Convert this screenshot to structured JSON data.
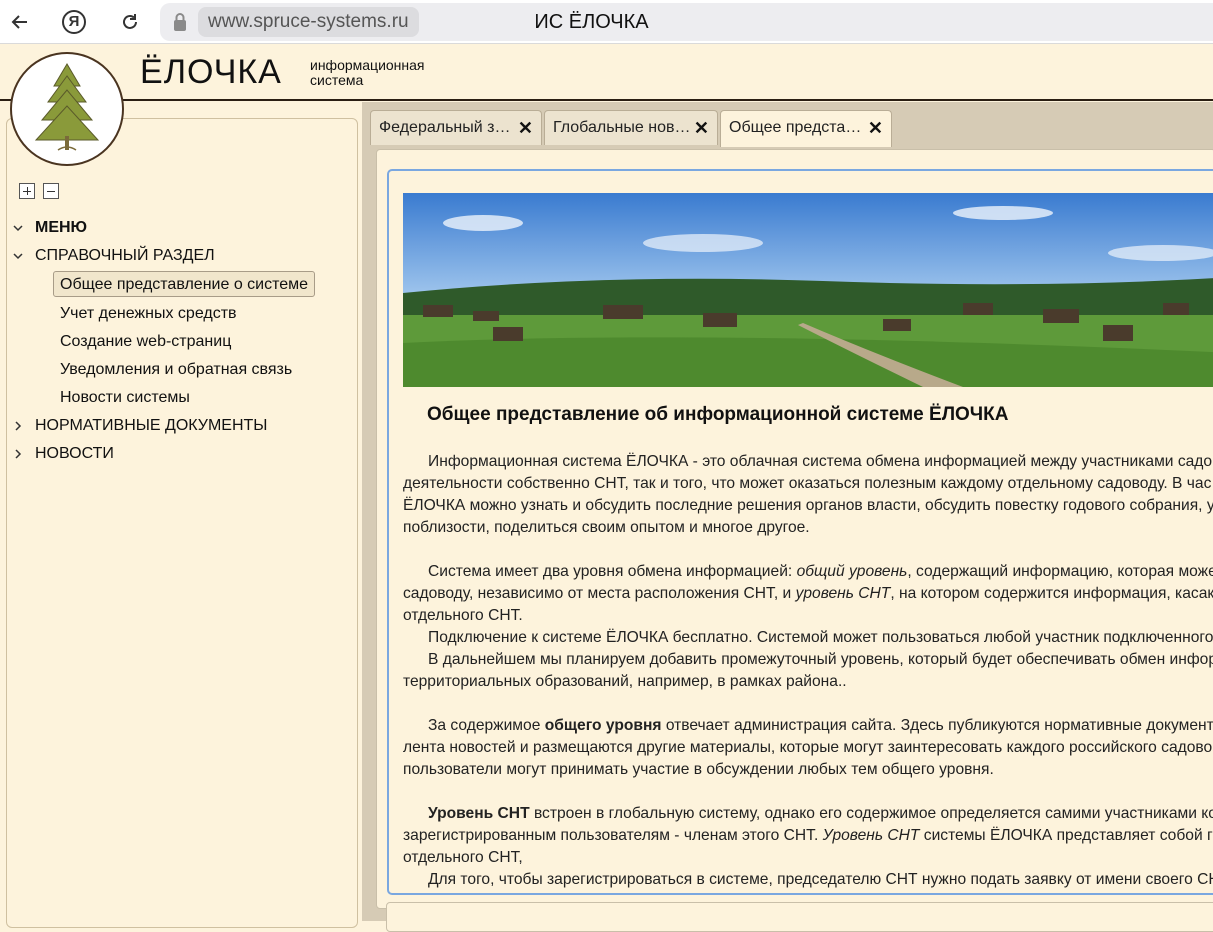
{
  "browser": {
    "url": "www.spruce-systems.ru",
    "tab_title": "ИС ЁЛОЧКА"
  },
  "header": {
    "title": "ЁЛОЧКА",
    "subtitle_line1": "информационная",
    "subtitle_line2": "система"
  },
  "sidebar": {
    "menu_label": "МЕНЮ",
    "sections": [
      {
        "label": "СПРАВОЧНЫЙ РАЗДЕЛ",
        "expanded": true,
        "items": [
          {
            "label": "Общее представление о системе",
            "selected": true
          },
          {
            "label": "Учет денежных средств"
          },
          {
            "label": "Создание web-страниц"
          },
          {
            "label": "Уведомления и обратная связь"
          },
          {
            "label": "Новости системы"
          }
        ]
      },
      {
        "label": "НОРМАТИВНЫЕ ДОКУМЕНТЫ",
        "expanded": false
      },
      {
        "label": "НОВОСТИ",
        "expanded": false
      }
    ]
  },
  "tabs": [
    {
      "label": "Федеральный з…"
    },
    {
      "label": "Глобальные нов…"
    },
    {
      "label": "Общее предста…",
      "active": true
    }
  ],
  "article": {
    "title": "Общее представление об информационной системе ЁЛОЧКА",
    "p1": [
      "Информационная система ЁЛОЧКА  - это облачная система обмена информацией между участниками садо",
      "деятельности  собственно СНТ, так и того, что может оказаться полезным каждому отдельному садоводу. В час",
      "ЁЛОЧКА можно узнать и обсудить последние решения органов власти, обсудить повестку годового собрания, у",
      "поблизости, поделиться своим опытом и многое другое."
    ],
    "p2_pre": "Система имеет два уровня обмена информацией: ",
    "p2_em1": "общий уровень",
    "p2_mid": ", содержащий информацию, которая може",
    "p2_line2_pre": "садоводу, независимо от места расположения СНТ, и ",
    "p2_em2": "уровень СНТ",
    "p2_line2_post": ", на котором содержится информация, касак",
    "p2_line3": "отдельного СНТ.",
    "p3": "Подключение к системе ЁЛОЧКА  бесплатно. Системой может пользоваться любой участник подключенного",
    "p4_line1": "В дальнейшем мы планируем добавить промежуточный уровень, который будет обеспечивать обмен инфор",
    "p4_line2": "территориальных образований, например, в рамках района..",
    "p5_pre": "За содержимое ",
    "p5_bold": "общего уровня",
    "p5_post": " отвечает администрация сайта. Здесь публикуются нормативные документ",
    "p5_line2": "лента новостей и размещаются другие материалы, которые могут заинтересовать каждого российского садово",
    "p5_line3": "пользователи могут принимать участие в обсуждении любых тем общего уровня.",
    "p6_bold": "Уровень СНТ",
    "p6_post": " встроен в глобальную систему, однако его содержимое определяется самими участниками ко",
    "p6_line2_pre": "зарегистрированным пользователям - членам этого СНТ. ",
    "p6_line2_em": "Уровень СНТ",
    "p6_line2_post": " системы ЁЛОЧКА представляет собой г",
    "p6_line3": "отдельного СНТ,",
    "p7": "Для того, чтобы зарегистрироваться в системе, председателю СНТ нужно подать заявку от имени своего СН"
  },
  "colors": {
    "background": "#fdf3dc",
    "panel_border": "#7aa7e0",
    "header_rule": "#2a1e12",
    "tree_green": "#8a9a3a"
  }
}
